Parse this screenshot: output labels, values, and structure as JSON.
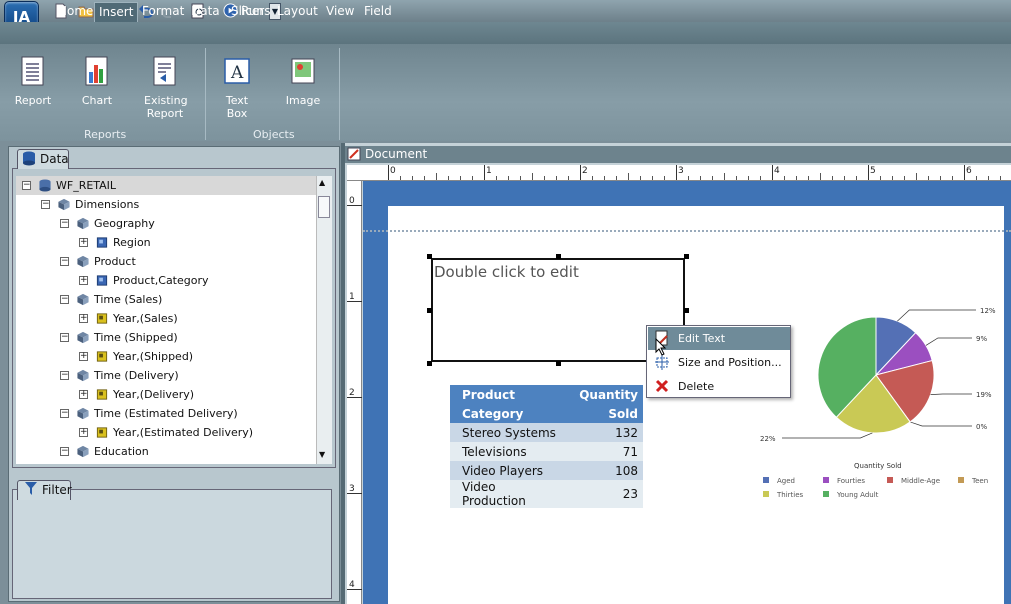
{
  "app": {
    "logo_text": "IA"
  },
  "quick_access": {
    "run_label": "Run"
  },
  "tabs": [
    "Home",
    "Insert",
    "Format",
    "Data",
    "Slicers",
    "Layout",
    "View",
    "Field"
  ],
  "ribbon": {
    "reports_group": {
      "label": "Reports",
      "buttons": [
        "Report",
        "Chart",
        "Existing Report"
      ]
    },
    "objects_group": {
      "label": "Objects",
      "buttons": [
        "Text Box",
        "Image"
      ]
    }
  },
  "data_panel": {
    "title": "Data",
    "tree": [
      {
        "level": 0,
        "label": "WF_RETAIL",
        "toggle": "−",
        "icon": "database-icon"
      },
      {
        "level": 1,
        "label": "Dimensions",
        "toggle": "−",
        "icon": "dimensions-icon"
      },
      {
        "level": 2,
        "label": "Geography",
        "toggle": "−",
        "icon": "dimensions-icon"
      },
      {
        "level": 3,
        "label": "Region",
        "toggle": "+",
        "icon": "hierarchy-blue-icon"
      },
      {
        "level": 2,
        "label": "Product",
        "toggle": "−",
        "icon": "dimensions-icon"
      },
      {
        "level": 3,
        "label": "Product,Category",
        "toggle": "+",
        "icon": "hierarchy-blue-icon"
      },
      {
        "level": 2,
        "label": "Time (Sales)",
        "toggle": "−",
        "icon": "dimensions-icon"
      },
      {
        "level": 3,
        "label": "Year,(Sales)",
        "toggle": "+",
        "icon": "hierarchy-yellow-icon"
      },
      {
        "level": 2,
        "label": "Time (Shipped)",
        "toggle": "−",
        "icon": "dimensions-icon"
      },
      {
        "level": 3,
        "label": "Year,(Shipped)",
        "toggle": "+",
        "icon": "hierarchy-yellow-icon"
      },
      {
        "level": 2,
        "label": "Time (Delivery)",
        "toggle": "−",
        "icon": "dimensions-icon"
      },
      {
        "level": 3,
        "label": "Year,(Delivery)",
        "toggle": "+",
        "icon": "hierarchy-yellow-icon"
      },
      {
        "level": 2,
        "label": "Time (Estimated Delivery)",
        "toggle": "−",
        "icon": "dimensions-icon"
      },
      {
        "level": 3,
        "label": "Year,(Estimated Delivery)",
        "toggle": "+",
        "icon": "hierarchy-yellow-icon"
      },
      {
        "level": 2,
        "label": "Education",
        "toggle": "−",
        "icon": "dimensions-icon"
      }
    ]
  },
  "filter_panel": {
    "title": "Filter"
  },
  "document": {
    "title": "Document",
    "ruler_h": [
      "0",
      "1",
      "2",
      "3",
      "4",
      "5",
      "6"
    ],
    "ruler_v": [
      "0",
      "1",
      "2",
      "3",
      "4"
    ],
    "textbox_text": "Double click to edit"
  },
  "report_table": {
    "headers": [
      [
        "Product",
        "Category"
      ],
      [
        "Quantity",
        "Sold"
      ]
    ],
    "rows": [
      {
        "category": "Stereo Systems",
        "qty": "132"
      },
      {
        "category": "Televisions",
        "qty": "71"
      },
      {
        "category": "Video Players",
        "qty": "108"
      },
      {
        "category": "Video Production",
        "qty": "23"
      }
    ]
  },
  "context_menu": {
    "items": [
      "Edit Text",
      "Size and Position...",
      "Delete"
    ]
  },
  "chart_data": {
    "type": "pie",
    "title": "Quantity Sold",
    "series": [
      {
        "name": "Aged",
        "value": 12,
        "label": "12%",
        "color": "#5470b5"
      },
      {
        "name": "Fourties",
        "value": 9,
        "label": "9%",
        "color": "#9b4fc0"
      },
      {
        "name": "Middle-Age",
        "value": 19,
        "label": "19%",
        "color": "#c55a55"
      },
      {
        "name": "Teen",
        "value": 0,
        "label": "0%",
        "color": "#c39a55"
      },
      {
        "name": "Thirties",
        "value": 22,
        "label": "22%",
        "color": "#c9c955"
      },
      {
        "name": "Young Adult",
        "value": 38,
        "label": "",
        "color": "#56b061"
      }
    ],
    "legend_position": "bottom"
  }
}
